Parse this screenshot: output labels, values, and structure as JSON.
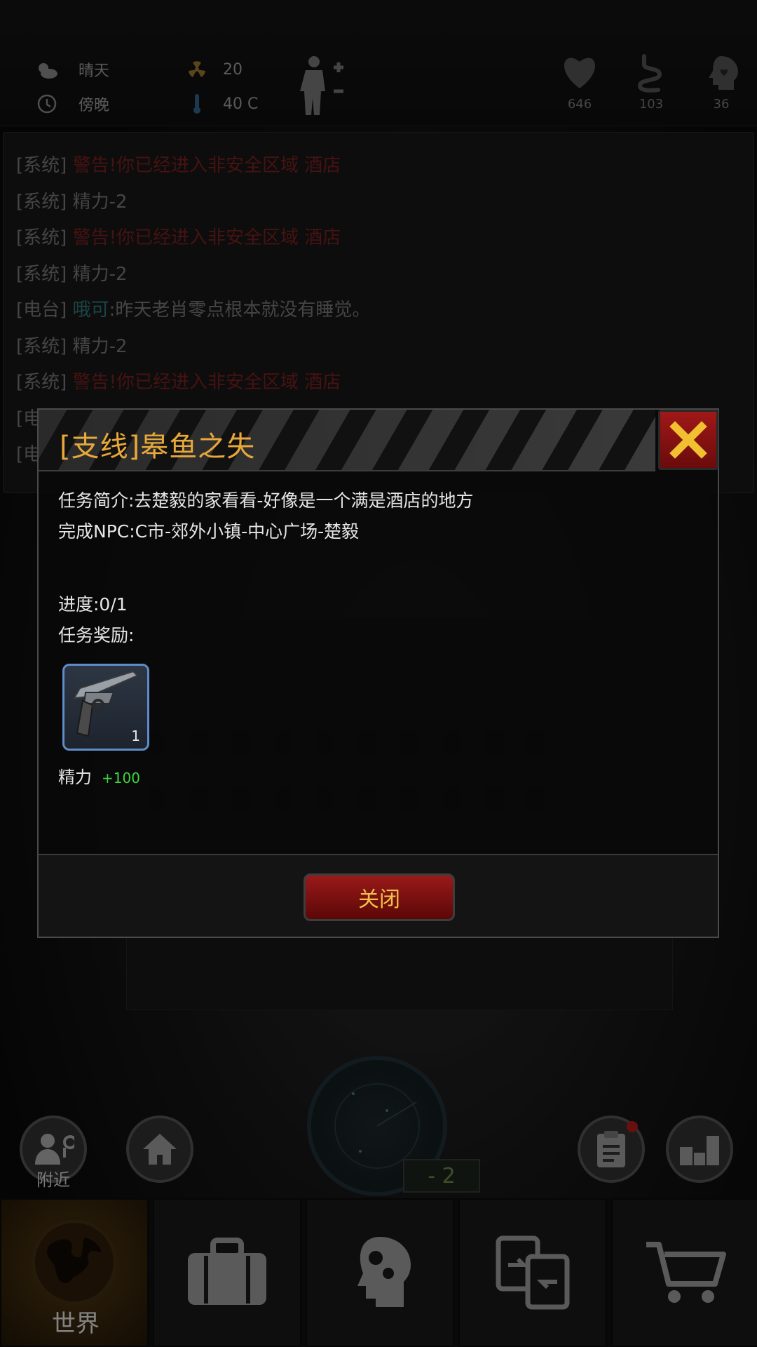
{
  "status": {
    "weather": "晴天",
    "time_of_day": "傍晚",
    "radiation": "20",
    "temperature": "40 C",
    "health": "646",
    "hunger": "103",
    "mood": "36"
  },
  "log": [
    {
      "tag": "[系统]",
      "highlight": "警告!你已经进入非安全区域 酒店",
      "text": ""
    },
    {
      "tag": "[系统]",
      "highlight": "",
      "text": "精力-2"
    },
    {
      "tag": "[系统]",
      "highlight": "警告!你已经进入非安全区域 酒店",
      "text": ""
    },
    {
      "tag": "[系统]",
      "highlight": "",
      "text": "精力-2"
    },
    {
      "tag": "[电台]",
      "name": "哦可",
      "text": ":昨天老肖零点根本就没有睡觉。"
    },
    {
      "tag": "[系统]",
      "highlight": "",
      "text": "精力-2"
    },
    {
      "tag": "[系统]",
      "highlight": "警告!你已经进入非安全区域 酒店",
      "text": ""
    },
    {
      "tag": "[电",
      "highlight": "",
      "text": ""
    },
    {
      "tag": "[电",
      "highlight": "",
      "text": ""
    }
  ],
  "modal": {
    "title": "[支线]皋鱼之失",
    "description": "任务简介:去楚毅的家看看-好像是一个满是酒店的地方",
    "npc": "完成NPC:C市-郊外小镇-中心广场-楚毅",
    "progress": "进度:0/1",
    "reward_label": "任务奖励:",
    "reward_item_count": "1",
    "reward_stat_name": "精力",
    "reward_stat_value": "+100",
    "close_label": "关闭"
  },
  "bottom": {
    "nearby_label": "附近",
    "radar_value": "- 2"
  },
  "tabs": [
    {
      "label": "世界",
      "icon": "globe-icon"
    },
    {
      "label": "",
      "icon": "briefcase-icon"
    },
    {
      "label": "",
      "icon": "head-gears-icon"
    },
    {
      "label": "",
      "icon": "swap-icon"
    },
    {
      "label": "",
      "icon": "cart-icon"
    }
  ],
  "colors": {
    "title_gold": "#e8a83a",
    "warning_red": "#6e1c1c",
    "button_red": "#9a1a1a",
    "reward_green": "#3fd43f",
    "slot_blue": "#5d8cc8"
  }
}
